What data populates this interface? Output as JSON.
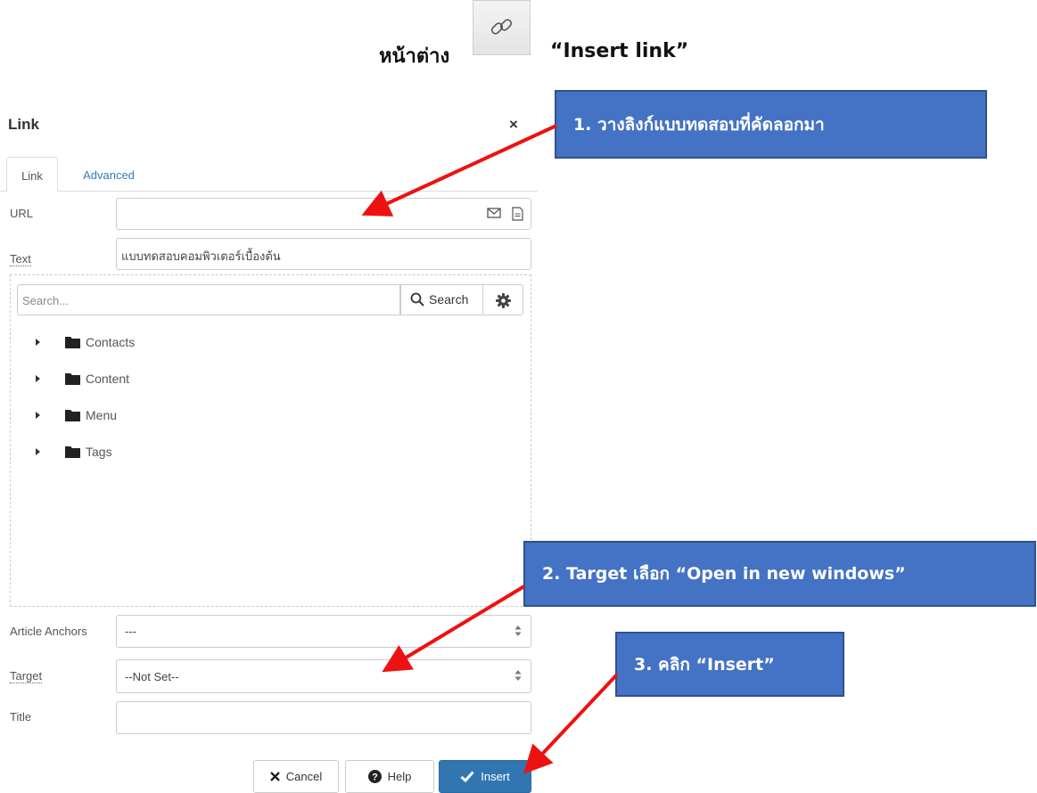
{
  "heading": {
    "left_text": "หน้าต่าง",
    "right_text": "“Insert link”",
    "button_icon": "link-icon"
  },
  "dialog": {
    "title": "Link",
    "close_label": "×",
    "tabs": [
      {
        "label": "Link",
        "active": true
      },
      {
        "label": "Advanced",
        "active": false
      }
    ],
    "url": {
      "label": "URL",
      "value": "",
      "icons": [
        "mail-icon",
        "file-icon"
      ]
    },
    "text": {
      "label": "Text",
      "value": "แบบทดสอบคอมพิวเตอร์เบื้องต้น"
    },
    "browser": {
      "search_placeholder": "Search...",
      "search_button": "Search",
      "settings_icon": "gear-icon",
      "tree": [
        "Contacts",
        "Content",
        "Menu",
        "Tags"
      ]
    },
    "anchors": {
      "label": "Article Anchors",
      "value": "---"
    },
    "target": {
      "label": "Target",
      "value": "--Not Set--"
    },
    "title_field": {
      "label": "Title",
      "value": ""
    },
    "buttons": {
      "cancel": "Cancel",
      "help": "Help",
      "insert": "Insert"
    }
  },
  "callouts": [
    "1. วางลิงก์แบบทดสอบที่คัดลอกมา",
    "2. Target เลือก “Open in new windows”",
    "3. คลิก “Insert”"
  ],
  "colors": {
    "callout_fill": "#4472c4",
    "arrow": "#ee1111",
    "insert_button": "#3276b1",
    "tab_link": "#337ab7"
  }
}
